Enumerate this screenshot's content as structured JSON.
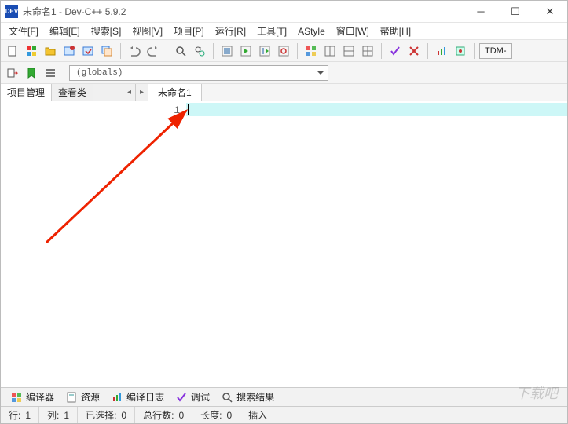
{
  "window": {
    "title": "未命名1 - Dev-C++ 5.9.2",
    "app_icon_text": "DEV"
  },
  "menu": {
    "items": [
      "文件[F]",
      "编辑[E]",
      "搜索[S]",
      "视图[V]",
      "项目[P]",
      "运行[R]",
      "工具[T]",
      "AStyle",
      "窗口[W]",
      "帮助[H]"
    ]
  },
  "toolbar1": {
    "icons": [
      "new-file-icon",
      "colors-icon",
      "open-icon",
      "new-project-icon",
      "open-project-icon",
      "save-all-icon"
    ],
    "nav_icons": [
      "undo-icon",
      "redo-icon"
    ],
    "search_icons": [
      "find-icon",
      "replace-icon"
    ],
    "build_icons": [
      "compile-icon",
      "run-icon",
      "compile-run-icon",
      "rebuild-icon"
    ],
    "window_icons": [
      "layout1-icon",
      "layout2-icon",
      "layout3-icon",
      "layout4-icon"
    ],
    "debug_icons": [
      "check-icon",
      "cross-icon"
    ],
    "misc_icons": [
      "chart-icon",
      "plugin-icon"
    ],
    "compiler_label": "TDM-"
  },
  "toolbar2": {
    "icons": [
      "goto-icon",
      "bookmark-add-icon",
      "bookmark-list-icon"
    ],
    "globals_label": "(globals)"
  },
  "left_panel": {
    "tabs": [
      "项目管理",
      "查看类"
    ]
  },
  "editor": {
    "tab": "未命名1",
    "line_number": "1"
  },
  "bottom_tabs": {
    "items": [
      {
        "icon": "grid-icon",
        "label": "编译器"
      },
      {
        "icon": "resource-icon",
        "label": "资源"
      },
      {
        "icon": "log-icon",
        "label": "编译日志"
      },
      {
        "icon": "debug-icon",
        "label": "调试"
      },
      {
        "icon": "search-result-icon",
        "label": "搜索结果"
      }
    ]
  },
  "status": {
    "row_label": "行:",
    "row_val": "1",
    "col_label": "列:",
    "col_val": "1",
    "sel_label": "已选择:",
    "sel_val": "0",
    "lines_label": "总行数:",
    "lines_val": "0",
    "len_label": "长度:",
    "len_val": "0",
    "mode": "插入"
  },
  "watermark": "下载吧"
}
